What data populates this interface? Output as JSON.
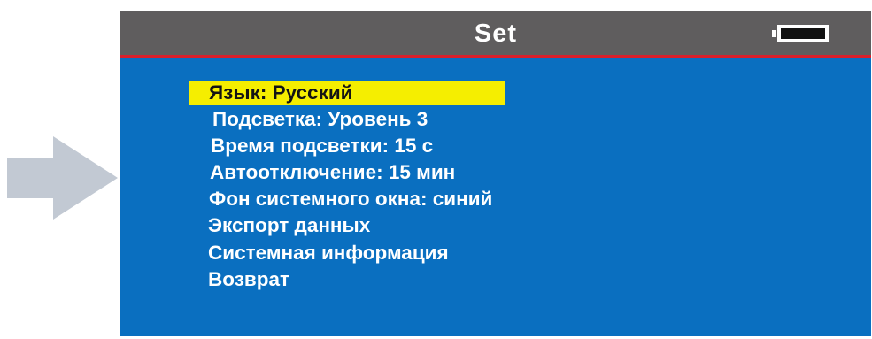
{
  "screen": {
    "title": "Set",
    "battery_icon": "battery-full-icon"
  },
  "menu": {
    "items": [
      {
        "label": "Язык: Русский",
        "selected": true
      },
      {
        "label": "Подсветка: Уровень 3",
        "selected": false
      },
      {
        "label": "Время подсветки: 15 с",
        "selected": false
      },
      {
        "label": "Автоотключение: 15 мин",
        "selected": false
      },
      {
        "label": "Фон системного окна: синий",
        "selected": false
      },
      {
        "label": "Экспорт данных",
        "selected": false
      },
      {
        "label": "Системная информация",
        "selected": false
      },
      {
        "label": "Возврат",
        "selected": false
      }
    ]
  },
  "pointer_icon": "arrow-right-icon",
  "colors": {
    "screen_background": "#0a6fc0",
    "title_bar": "#5f5d5e",
    "title_underline": "#d9202b",
    "selection_highlight": "#f5ee00",
    "arrow": "#c2c9d3"
  }
}
